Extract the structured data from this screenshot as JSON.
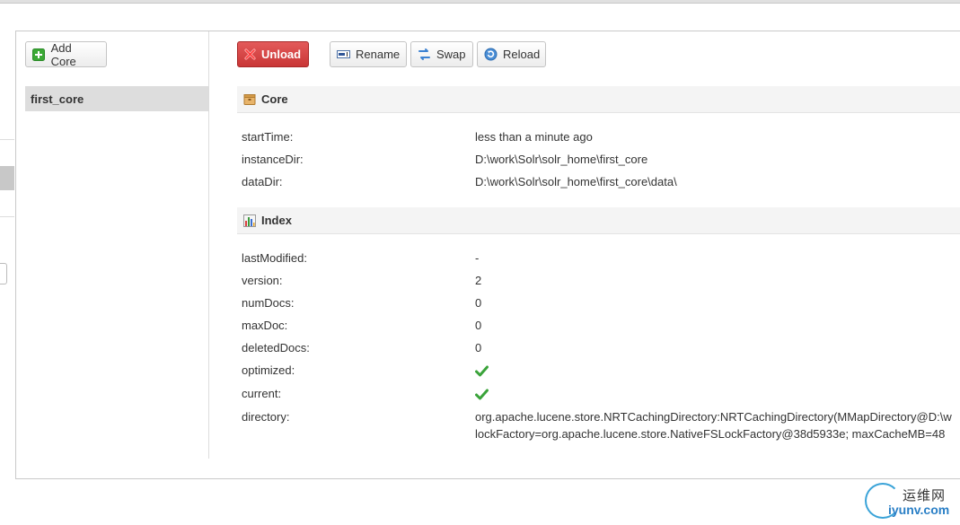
{
  "toolbar": {
    "add_core_label": "Add Core",
    "unload_label": "Unload",
    "rename_label": "Rename",
    "swap_label": "Swap",
    "reload_label": "Reload"
  },
  "cores": [
    {
      "name": "first_core",
      "selected": true
    }
  ],
  "core_section": {
    "title": "Core",
    "rows": [
      {
        "key": "startTime:",
        "value": "less than a minute ago"
      },
      {
        "key": "instanceDir:",
        "value": "D:\\work\\Solr\\solr_home\\first_core"
      },
      {
        "key": "dataDir:",
        "value": "D:\\work\\Solr\\solr_home\\first_core\\data\\"
      }
    ]
  },
  "index_section": {
    "title": "Index",
    "rows": [
      {
        "key": "lastModified:",
        "value": "-"
      },
      {
        "key": "version:",
        "value": "2"
      },
      {
        "key": "numDocs:",
        "value": "0"
      },
      {
        "key": "maxDoc:",
        "value": "0"
      },
      {
        "key": "deletedDocs:",
        "value": "0"
      },
      {
        "key": "optimized:",
        "value": true
      },
      {
        "key": "current:",
        "value": true
      },
      {
        "key": "directory:",
        "value": "org.apache.lucene.store.NRTCachingDirectory:NRTCachingDirectory(MMapDirectory@D:\\w",
        "value_line2": "lockFactory=org.apache.lucene.store.NativeFSLockFactory@38d5933e; maxCacheMB=48"
      }
    ]
  },
  "watermark": {
    "cn": "运维网",
    "url": "iyunv.com"
  },
  "colors": {
    "unload_bg": "#d64545",
    "check_green": "#3aa33a",
    "selected_core_bg": "#dddddd",
    "section_head_bg": "#f4f4f4"
  },
  "icons": {
    "add": "plus-box-icon",
    "unload": "x-icon",
    "rename": "rename-icon",
    "swap": "swap-icon",
    "reload": "reload-icon",
    "core": "box-icon",
    "index": "bar-chart-icon",
    "check": "checkmark-icon"
  }
}
